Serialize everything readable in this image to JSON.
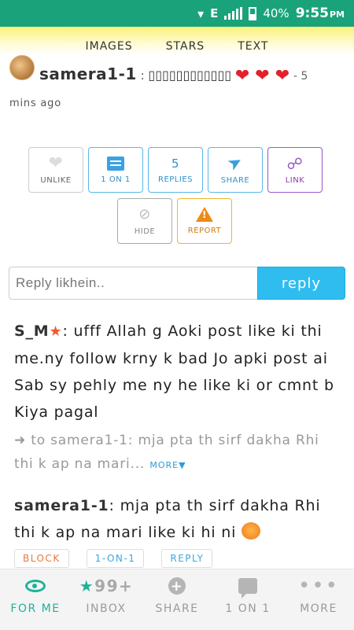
{
  "status_bar": {
    "network": "E",
    "battery": "40%",
    "time": "9:55",
    "ampm": "PM",
    "colors": {
      "background": "#1aa37a"
    }
  },
  "top_tabs": [
    "IMAGES",
    "STARS",
    "TEXT"
  ],
  "post": {
    "username": "samera1-1",
    "separator": ":",
    "text": "▯▯▯▯▯▯▯▯▯▯▯▯",
    "hearts": "❤ ❤ ❤",
    "time_ago_prefix": "- 5",
    "time_ago_suffix": "mins ago"
  },
  "actions": {
    "unlike": "UNLIKE",
    "one_on_one": "1 ON 1",
    "replies_count": "5",
    "replies": "REPLIES",
    "share": "SHARE",
    "link": "LINK",
    "hide": "HIDE",
    "report": "REPORT"
  },
  "reply_box": {
    "placeholder": "Reply likhein..",
    "button": "reply",
    "colors": {
      "button": "#2fbdf0"
    }
  },
  "comments": [
    {
      "username": "S_M",
      "separator": ":",
      "text": "ufff Allah g Aoki post like ki thi me.ny follow krny k bad Jo apki post ai Sab sy pehly me ny he like ki or cmnt b Kiya pagal",
      "quote_prefix": "➜ to samera1-1:",
      "quote_text": "mja pta th sirf dakha Rhi thi k ap na mari...",
      "more": "MORE▼"
    },
    {
      "username": "samera1-1",
      "separator": ":",
      "text": "mja pta th sirf dakha Rhi thi k ap na mari like ki hi ni",
      "emoji": "angry-face-icon",
      "actions": [
        "BLOCK",
        "1-ON-1",
        "REPLY"
      ]
    }
  ],
  "bottom_nav": [
    {
      "label": "FOR ME",
      "icon": "eye-icon",
      "active": true
    },
    {
      "label": "INBOX",
      "icon": "star-icon",
      "badge": "99+"
    },
    {
      "label": "SHARE",
      "icon": "plus-icon"
    },
    {
      "label": "1 ON 1",
      "icon": "chat-icon"
    },
    {
      "label": "MORE",
      "icon": "dots-icon"
    }
  ],
  "colors": {
    "accent": "#1fb29a",
    "link_blue": "#2f9bd8",
    "heart": "#e2212b"
  }
}
